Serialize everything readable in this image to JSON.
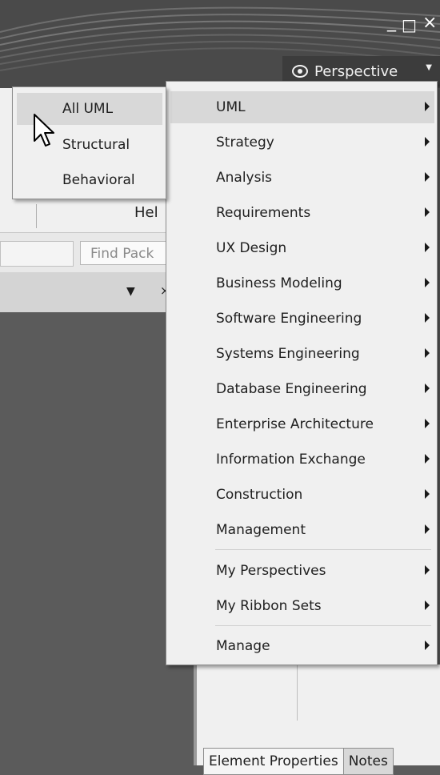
{
  "window": {
    "minimize_icon": "minimize-icon",
    "maximize_icon": "maximize-icon",
    "close_icon": "close-icon",
    "minimize": "_",
    "maximize": "□",
    "close": "×"
  },
  "perspective_button": {
    "label": "Perspective",
    "icon": "eye-icon"
  },
  "ribbon": {
    "help_label": "Hel"
  },
  "search": {
    "find_packages_placeholder": "Find Pack"
  },
  "menu": {
    "items": [
      {
        "label": "UML",
        "has_submenu": true,
        "highlighted": true
      },
      {
        "label": "Strategy",
        "has_submenu": true
      },
      {
        "label": "Analysis",
        "has_submenu": true
      },
      {
        "label": "Requirements",
        "has_submenu": true
      },
      {
        "label": "UX Design",
        "has_submenu": true
      },
      {
        "label": "Business Modeling",
        "has_submenu": true
      },
      {
        "label": "Software Engineering",
        "has_submenu": true
      },
      {
        "label": "Systems Engineering",
        "has_submenu": true
      },
      {
        "label": "Database Engineering",
        "has_submenu": true
      },
      {
        "label": "Enterprise Architecture",
        "has_submenu": true
      },
      {
        "label": "Information Exchange",
        "has_submenu": true
      },
      {
        "label": "Construction",
        "has_submenu": true
      },
      {
        "label": "Management",
        "has_submenu": true
      },
      {
        "label": "My Perspectives",
        "has_submenu": true
      },
      {
        "label": "My Ribbon Sets",
        "has_submenu": true
      },
      {
        "label": "Manage",
        "has_submenu": true
      }
    ]
  },
  "submenu": {
    "items": [
      {
        "label": "All UML",
        "highlighted": true
      },
      {
        "label": "Structural"
      },
      {
        "label": "Behavioral"
      }
    ]
  },
  "bottom_tabs": [
    {
      "label": "Element Properties",
      "active": true
    },
    {
      "label": "Notes"
    }
  ],
  "colors": {
    "titlebar": "#4a4a4a",
    "menu_background": "#f0f0f0",
    "menu_highlight": "#d8d8d8",
    "workspace": "#5b5b5b"
  }
}
